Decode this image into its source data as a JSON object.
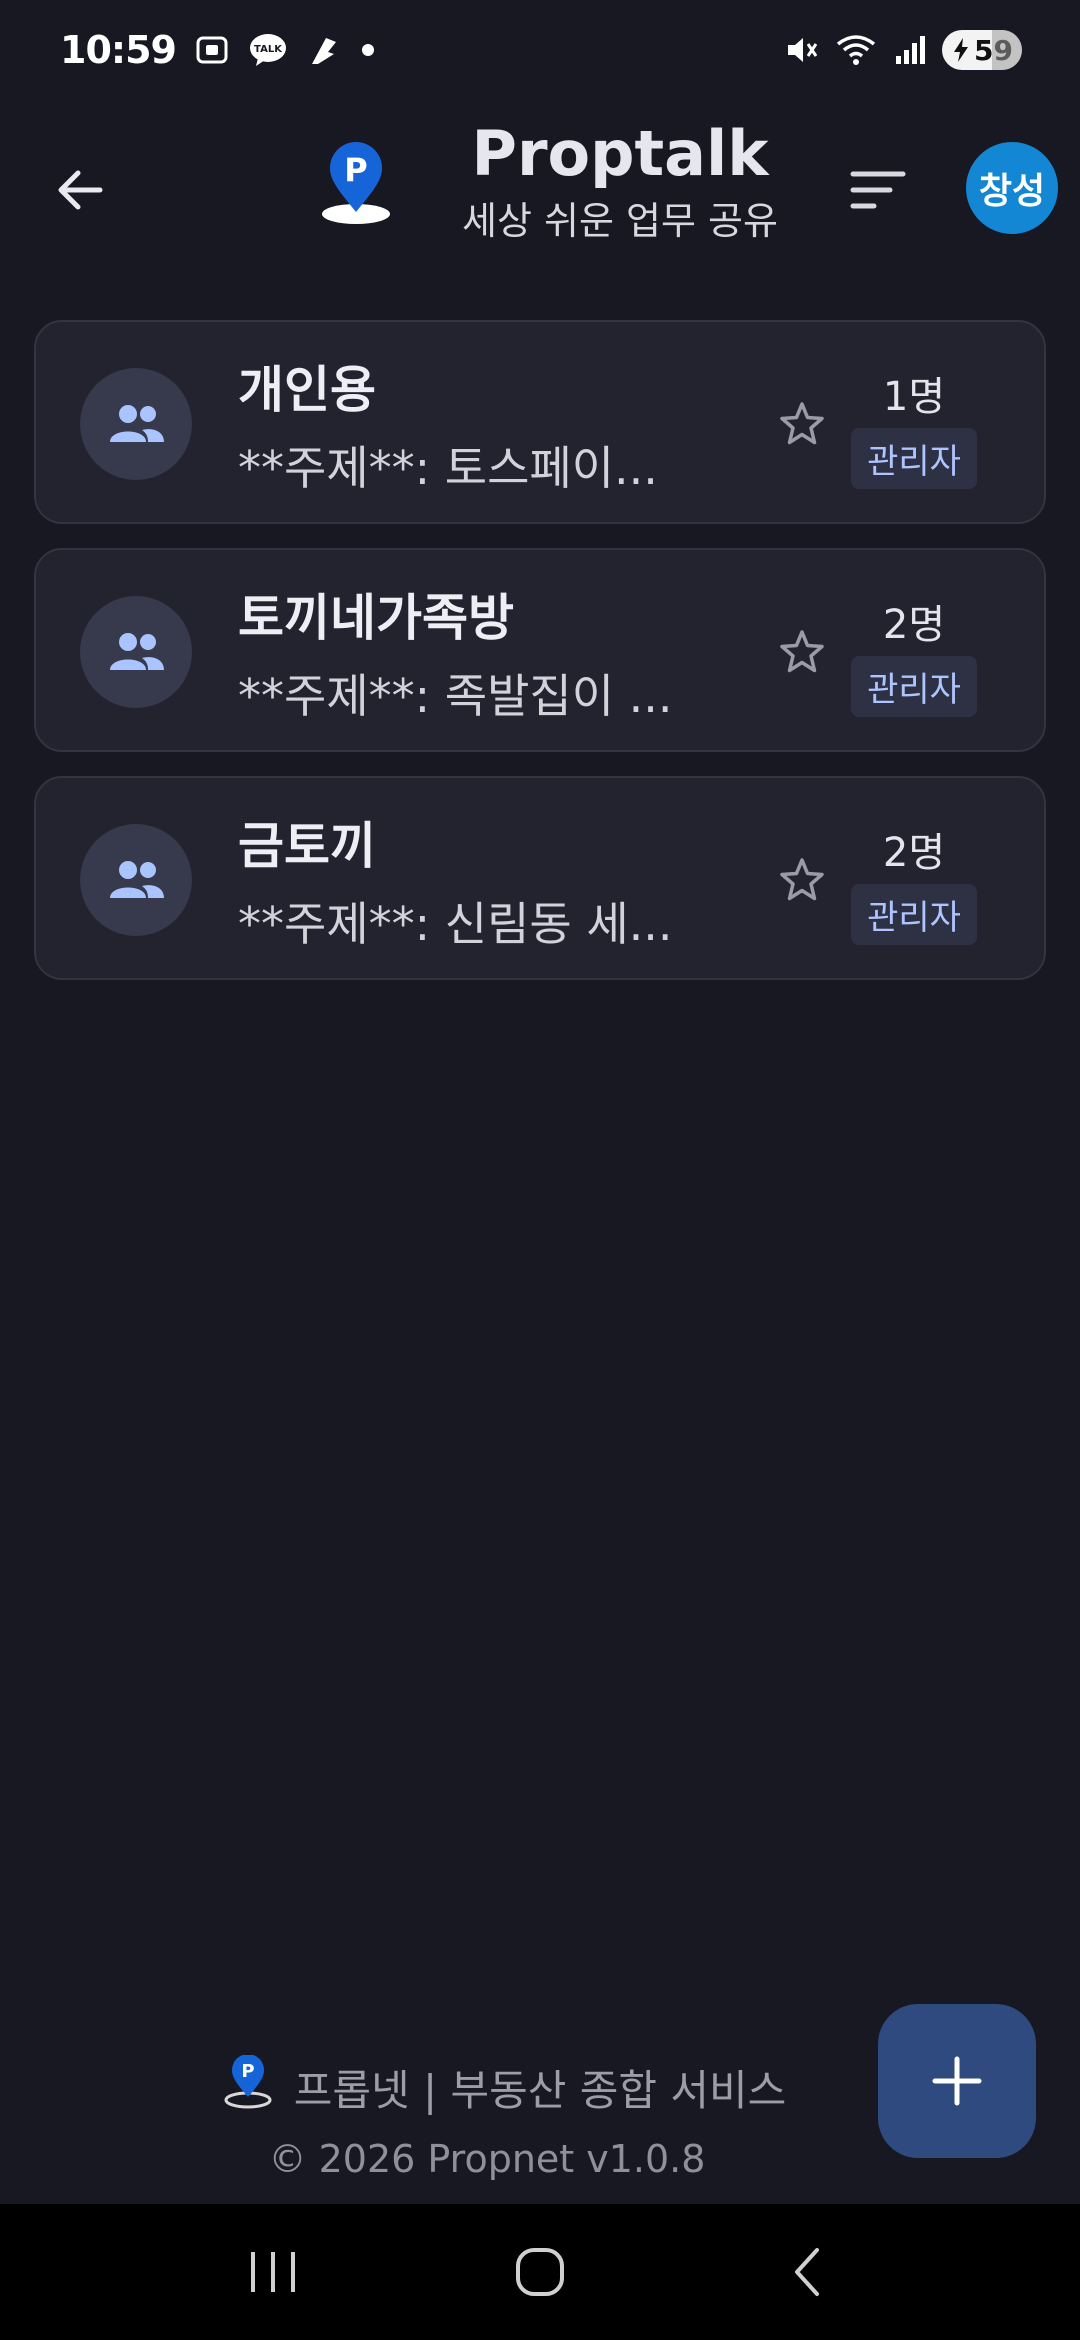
{
  "status_bar": {
    "time": "10:59",
    "battery_level": "59",
    "icons": [
      "screenshot-icon",
      "kakaotalk-icon",
      "app-notification-icon",
      "dot-icon",
      "mute-icon",
      "wifi-icon",
      "signal-icon",
      "battery-icon"
    ]
  },
  "header": {
    "title": "Proptalk",
    "subtitle": "세상 쉬운 업무 공유",
    "avatar_label": "창성",
    "logo_letter": "P"
  },
  "rooms": [
    {
      "name": "개인용",
      "topic": "**주제**: 토스페이...",
      "count": "1명",
      "role": "관리자"
    },
    {
      "name": "토끼네가족방",
      "topic": "**주제**: 족발집이 ...",
      "count": "2명",
      "role": "관리자"
    },
    {
      "name": "금토끼",
      "topic": "**주제**: 신림동 세...",
      "count": "2명",
      "role": "관리자"
    }
  ],
  "footer": {
    "service_text": "프롭넷 | 부동산 종합 서비스",
    "copyright": "© 2026 Propnet  v1.0.8"
  },
  "colors": {
    "background": "#171821",
    "card": "#22232f",
    "accent": "#1487d4",
    "fab": "#2f4a7f",
    "badge_text": "#aec4ff"
  }
}
